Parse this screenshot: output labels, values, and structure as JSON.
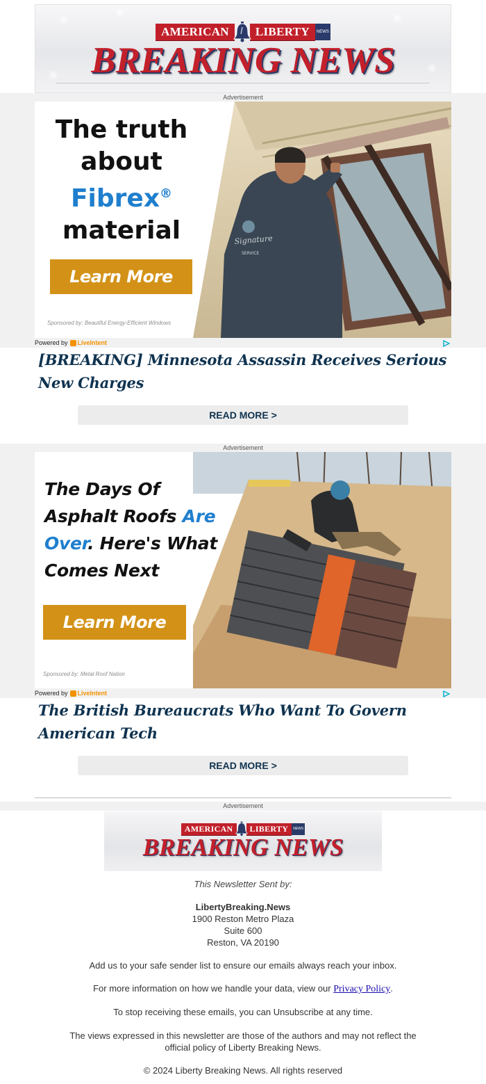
{
  "brand": {
    "left_word": "AMERICAN",
    "right_word": "LIBERTY",
    "tag": "NEWS",
    "title": "BREAKING NEWS"
  },
  "ads": [
    {
      "label": "Advertisement",
      "headline_lines": [
        "The truth",
        "about",
        "Fibrex",
        "material"
      ],
      "fibrex_mark": "®",
      "cta": "Learn More",
      "sponsored": "Sponsored by: Beautiful Energy-Efficient Windows",
      "powered_by": "Powered by",
      "provider": "LiveIntent"
    },
    {
      "label": "Advertisement",
      "headline_lines": [
        "The Days Of",
        "Asphalt Roofs",
        "Are",
        "Over",
        ". Here's What",
        "Comes Next"
      ],
      "cta": "Learn More",
      "sponsored": "Sponsored by: Metal Roof Nation",
      "powered_by": "Powered by",
      "provider": "LiveIntent"
    }
  ],
  "articles": [
    {
      "title": "[BREAKING] Minnesota Assassin Receives Serious New Charges",
      "read_more": "READ MORE >"
    },
    {
      "title": "The British Bureaucrats Who Want To Govern American Tech",
      "read_more": "READ MORE >"
    }
  ],
  "footer": {
    "ad_label": "Advertisement",
    "sent_by": "This Newsletter Sent by:",
    "org_name": "LibertyBreaking.News",
    "address_1": "1900 Reston Metro Plaza",
    "address_2": "Suite 600",
    "address_3": "Reston, VA 20190",
    "safe_sender": "Add us to your safe sender list to ensure our emails always reach your inbox.",
    "privacy_prefix": "For more information on how we handle your data, view our",
    "privacy_link": "Privacy Policy",
    "privacy_suffix": ".",
    "unsubscribe": "To stop receiving these emails, you can Unsubscribe at any time.",
    "views_1": "The views expressed in this newsletter are those of the authors and may not reflect the",
    "views_2": "official policy of Liberty Breaking News.",
    "copyright": "© 2024 Liberty Breaking News. All rights reserved"
  },
  "colors": {
    "brand_red": "#c1202a",
    "brand_navy": "#2a3b6a",
    "headline_navy": "#0f3350",
    "cta_gold": "#d39217",
    "accent_blue": "#1f7fce"
  }
}
